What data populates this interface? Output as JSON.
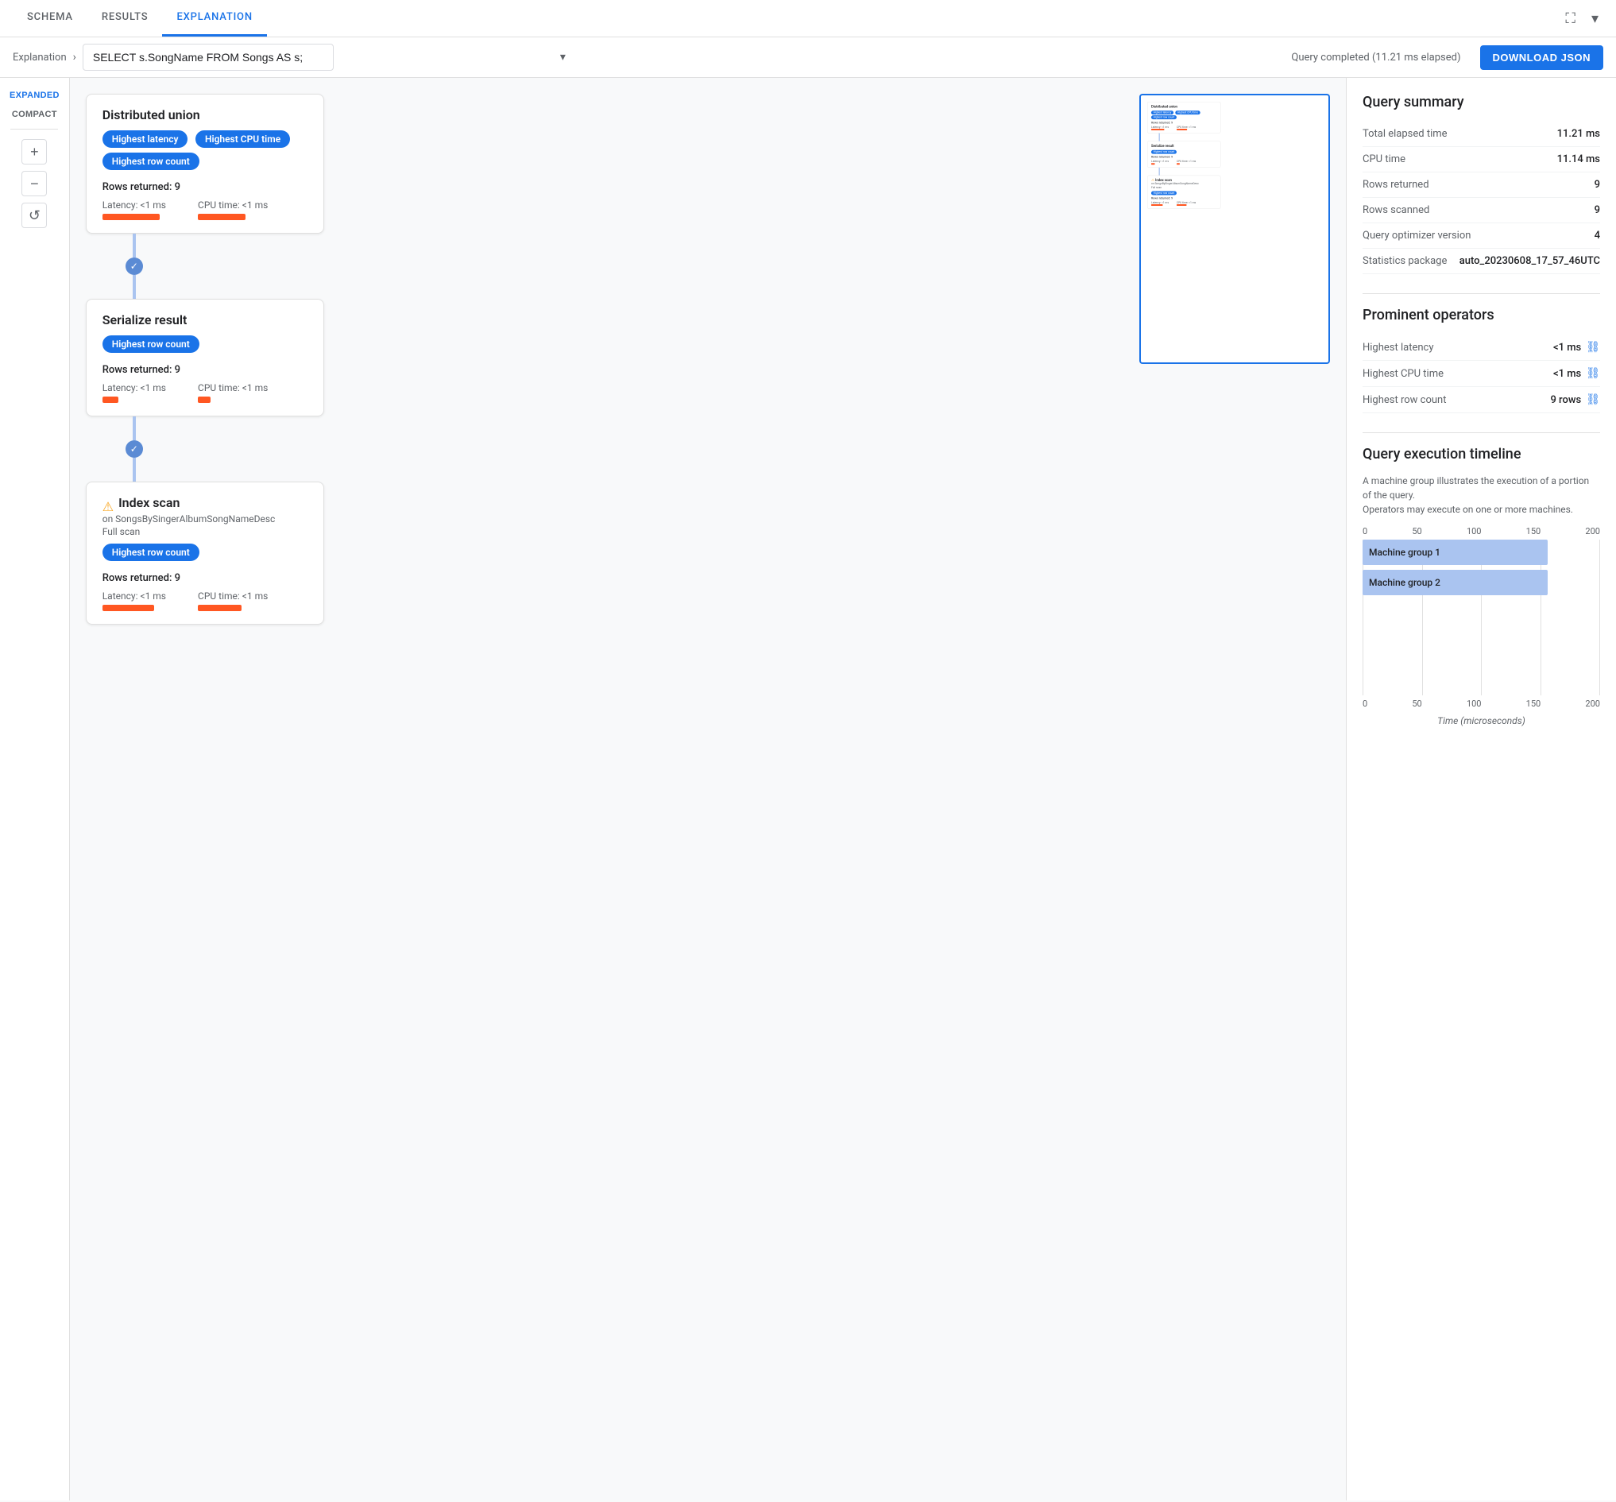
{
  "tabs": [
    {
      "id": "schema",
      "label": "SCHEMA"
    },
    {
      "id": "results",
      "label": "RESULTS"
    },
    {
      "id": "explanation",
      "label": "EXPLANATION",
      "active": true
    }
  ],
  "breadcrumb": {
    "label": "Explanation",
    "arrow": "›"
  },
  "query": {
    "text": "SELECT s.SongName FROM Songs AS s;",
    "status": "Query completed (11.21 ms elapsed)"
  },
  "download_btn": "DOWNLOAD JSON",
  "view_modes": [
    "EXPANDED",
    "COMPACT"
  ],
  "zoom": {
    "plus": "+",
    "minus": "−",
    "reset": "↺"
  },
  "nodes": [
    {
      "id": "distributed-union",
      "title": "Distributed union",
      "badges": [
        {
          "text": "Highest latency",
          "style": "blue"
        },
        {
          "text": "Highest CPU time",
          "style": "blue"
        },
        {
          "text": "Highest row count",
          "style": "blue"
        }
      ],
      "rows_returned": "Rows returned: 9",
      "latency_label": "Latency: <1 ms",
      "latency_bar_width": 72,
      "cpu_label": "CPU time: <1 ms",
      "cpu_bar_width": 60
    },
    {
      "id": "serialize-result",
      "title": "Serialize result",
      "badges": [
        {
          "text": "Highest row count",
          "style": "blue"
        }
      ],
      "rows_returned": "Rows returned: 9",
      "latency_label": "Latency: <1 ms",
      "latency_bar_width": 20,
      "cpu_label": "CPU time: <1 ms",
      "cpu_bar_width": 16
    },
    {
      "id": "index-scan",
      "title": "Index scan",
      "warning": true,
      "subtitle_on": "on SongsBySingerAlbumSongNameDesc",
      "subtitle_full": "Full scan",
      "badges": [
        {
          "text": "Highest row count",
          "style": "blue"
        }
      ],
      "rows_returned": "Rows returned: 9",
      "latency_label": "Latency: <1 ms",
      "latency_bar_width": 65,
      "cpu_label": "CPU time: <1 ms",
      "cpu_bar_width": 55
    }
  ],
  "query_summary": {
    "title": "Query summary",
    "rows": [
      {
        "label": "Total elapsed time",
        "value": "11.21 ms"
      },
      {
        "label": "CPU time",
        "value": "11.14 ms"
      },
      {
        "label": "Rows returned",
        "value": "9"
      },
      {
        "label": "Rows scanned",
        "value": "9"
      },
      {
        "label": "Query optimizer version",
        "value": "4"
      },
      {
        "label": "Statistics package",
        "value": "auto_20230608_17_57_46UTC"
      }
    ]
  },
  "prominent_operators": {
    "title": "Prominent operators",
    "rows": [
      {
        "label": "Highest latency",
        "value": "<1 ms"
      },
      {
        "label": "Highest CPU time",
        "value": "<1 ms"
      },
      {
        "label": "Highest row count",
        "value": "9 rows"
      }
    ]
  },
  "timeline": {
    "title": "Query execution timeline",
    "desc1": "A machine group illustrates the execution of a portion of the query.",
    "desc2": "Operators may execute on one or more machines.",
    "axis_top": [
      "0",
      "50",
      "100",
      "150",
      "200"
    ],
    "bars": [
      {
        "label": "Machine group 1",
        "width_pct": 78
      },
      {
        "label": "Machine group 2",
        "width_pct": 78
      }
    ],
    "axis_bottom": [
      "0",
      "50",
      "100",
      "150",
      "200"
    ],
    "x_label": "Time (microseconds)"
  },
  "minimap": {
    "nodes": [
      {
        "title": "Distributed union",
        "badges": [
          "Highest latency",
          "Highest CPU time",
          "Highest row count"
        ]
      },
      {
        "title": "Serialize result",
        "badges": [
          "Highest row count"
        ]
      },
      {
        "title": "Index scan",
        "badges": [
          "Highest row count"
        ]
      }
    ]
  }
}
